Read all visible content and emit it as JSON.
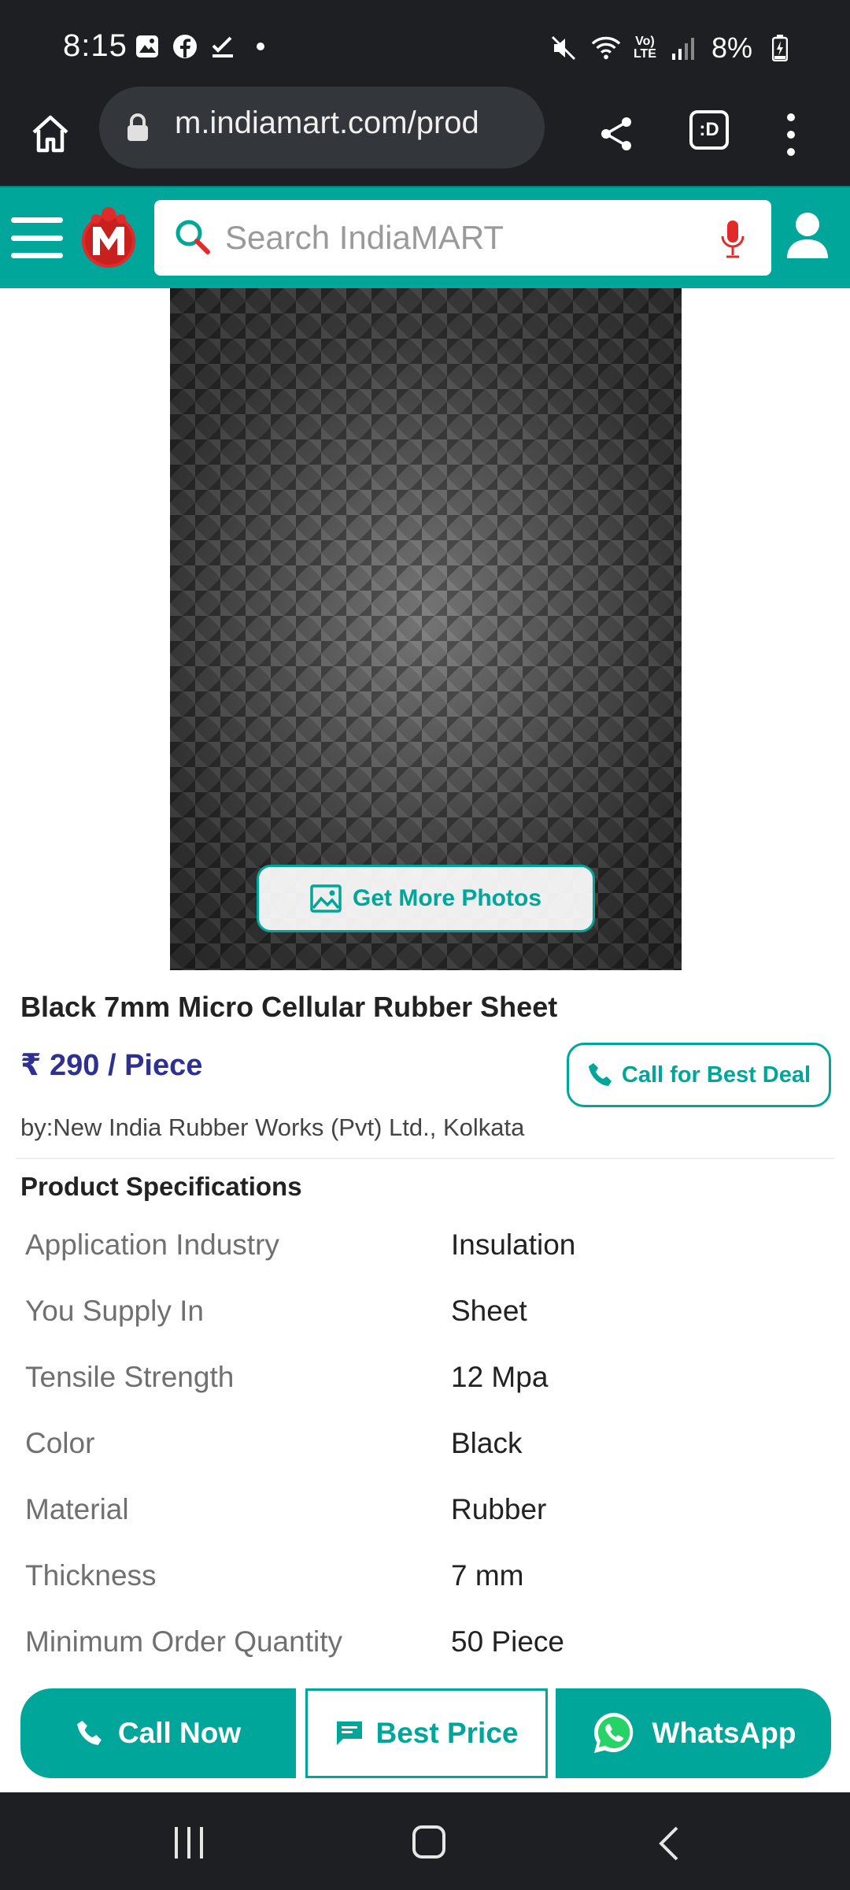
{
  "status_bar": {
    "time": "8:15",
    "battery": "8%",
    "network_label_top": "Vo)",
    "network_label_bottom": "LTE"
  },
  "browser": {
    "url": "m.indiamart.com/prod"
  },
  "header": {
    "search_placeholder": "Search IndiaMART"
  },
  "gallery": {
    "more_photos_label": "Get More Photos"
  },
  "product": {
    "title": "Black 7mm Micro Cellular Rubber Sheet",
    "price": "₹ 290 / Piece",
    "call_deal_label": "Call for Best Deal",
    "seller": "by:New India Rubber Works (Pvt) Ltd., Kolkata"
  },
  "specifications": {
    "title": "Product Specifications",
    "rows": [
      {
        "key": "Application Industry",
        "value": "Insulation"
      },
      {
        "key": "You Supply In",
        "value": "Sheet"
      },
      {
        "key": "Tensile Strength",
        "value": "12 Mpa"
      },
      {
        "key": "Color",
        "value": "Black"
      },
      {
        "key": "Material",
        "value": "Rubber"
      },
      {
        "key": "Thickness",
        "value": "7 mm"
      },
      {
        "key": "Minimum Order Quantity",
        "value": "50 Piece"
      }
    ]
  },
  "actions": {
    "call_now": "Call Now",
    "best_price": "Best Price",
    "whatsapp": "WhatsApp"
  },
  "colors": {
    "brand_teal": "#00a699",
    "price_blue": "#2e3192",
    "system_bar": "#1e1f22"
  }
}
